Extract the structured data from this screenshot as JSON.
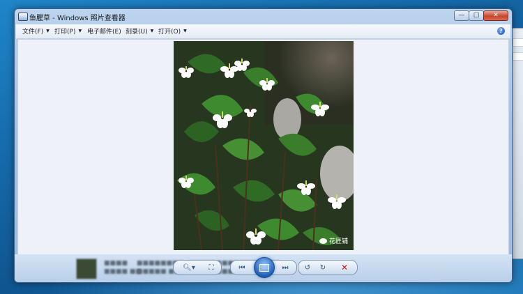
{
  "window": {
    "title": "鱼腥草 - Windows 照片查看器",
    "minimize_glyph": "—",
    "maximize_glyph": "□",
    "close_glyph": "✕"
  },
  "menu": {
    "items": [
      {
        "label": "文件(F)",
        "has_dropdown": true
      },
      {
        "label": "打印(P)",
        "has_dropdown": true
      },
      {
        "label": "电子邮件(E)",
        "has_dropdown": false
      },
      {
        "label": "刻录(U)",
        "has_dropdown": true
      },
      {
        "label": "打开(O)",
        "has_dropdown": true
      }
    ],
    "help_glyph": "?"
  },
  "photo": {
    "watermark": "花匠铺"
  },
  "toolbar": {
    "zoom_icon": "magnifier-icon",
    "fit_icon": "actual-size-icon",
    "prev_icon": "previous-icon",
    "slideshow_icon": "slideshow-icon",
    "next_icon": "next-icon",
    "rotate_ccw_icon": "rotate-counterclockwise-icon",
    "rotate_cw_icon": "rotate-clockwise-icon",
    "delete_icon": "delete-icon"
  },
  "colors": {
    "accent": "#1f5fb5",
    "delete": "#d21c1c",
    "desktop": "#1568a8"
  }
}
